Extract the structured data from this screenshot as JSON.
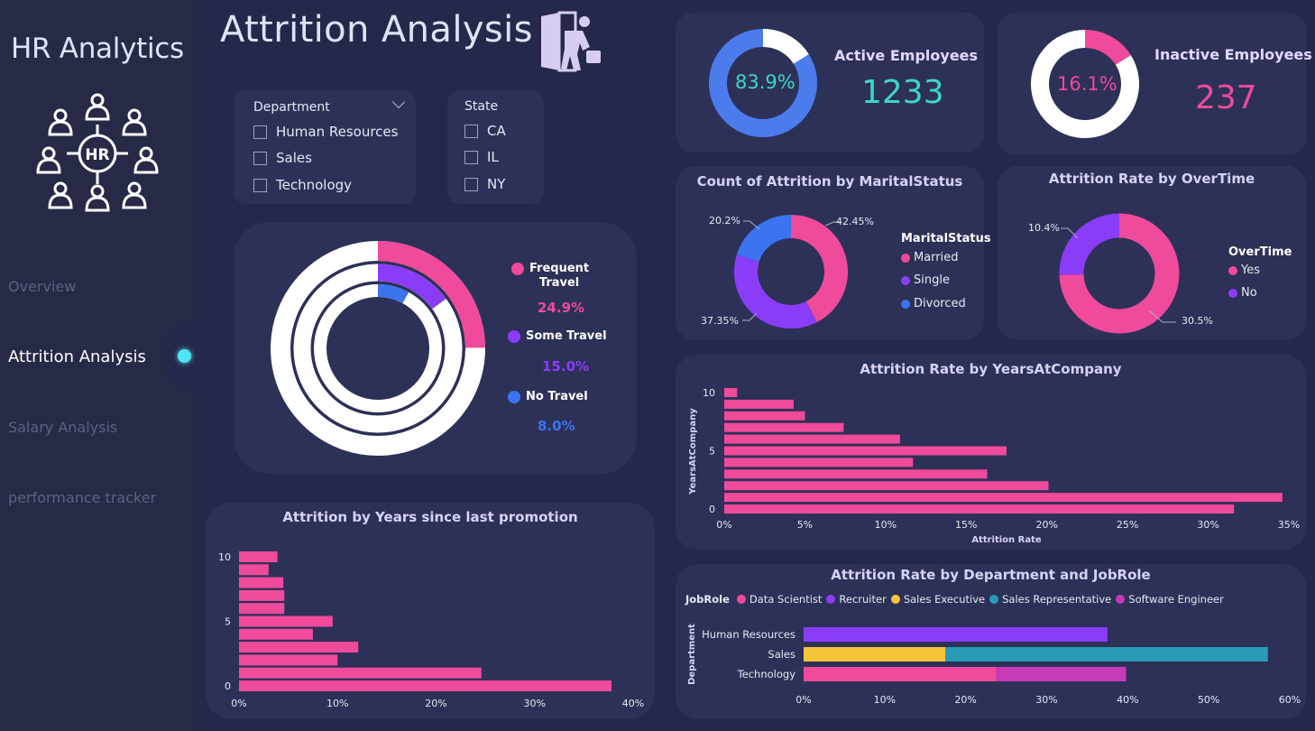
{
  "sidebar": {
    "app_title": "HR Analytics",
    "logo_text": "HR",
    "nav": [
      {
        "label": "Overview",
        "active": false
      },
      {
        "label": "Attrition Analysis",
        "active": true
      },
      {
        "label": "Salary Analysis",
        "active": false
      },
      {
        "label": "performance tracker",
        "active": false
      }
    ]
  },
  "page_title": "Attrition Analysis",
  "filters": {
    "department": {
      "title": "Department",
      "options": [
        "Human Resources",
        "Sales",
        "Technology"
      ]
    },
    "state": {
      "title": "State",
      "options": [
        "CA",
        "IL",
        "NY"
      ]
    }
  },
  "kpis": {
    "active": {
      "label": "Active Employees",
      "value": "1233",
      "percent_label": "83.9%",
      "percent": 83.9,
      "color": "#3ed6c8",
      "ring_color": "#4b7bec"
    },
    "inactive": {
      "label": "Inactive Employees",
      "value": "237",
      "percent_label": "16.1%",
      "percent": 16.1,
      "color": "#ef4a9b",
      "ring_color": "#ef4a9b"
    }
  },
  "colors": {
    "pink": "#ef4a9b",
    "purple": "#8b3cf7",
    "blue": "#3b73f0",
    "yellow": "#f7c53b",
    "teal": "#2a9bb7",
    "magenta": "#c63ab8"
  },
  "chart_data": [
    {
      "type": "pie",
      "title": "Count of Attrition by MaritalStatus",
      "legend_title": "MaritalStatus",
      "categories": [
        "Married",
        "Single",
        "Divorced"
      ],
      "values": [
        42.45,
        37.35,
        20.2
      ],
      "labels": [
        "42.45%",
        "37.35%",
        "20.2%"
      ],
      "colors": [
        "#ef4a9b",
        "#8b3cf7",
        "#3b73f0"
      ]
    },
    {
      "type": "pie",
      "title": "Attrition Rate by OverTime",
      "legend_title": "OverTime",
      "categories": [
        "Yes",
        "No"
      ],
      "values": [
        30.5,
        10.4
      ],
      "labels": [
        "30.5%",
        "10.4%"
      ],
      "colors": [
        "#ef4a9b",
        "#8b3cf7"
      ]
    },
    {
      "type": "pie",
      "title": "",
      "categories": [
        "Frequent Travel",
        "Some Travel",
        "No Travel"
      ],
      "values": [
        24.9,
        15.0,
        8.0
      ],
      "labels": [
        "24.9%",
        "15.0%",
        "8.0%"
      ],
      "colors": [
        "#ef4a9b",
        "#8b3cf7",
        "#3b73f0"
      ]
    },
    {
      "type": "bar",
      "orientation": "horizontal",
      "title": "Attrition Rate by YearsAtCompany",
      "xlabel": "Attrition Rate",
      "ylabel": "YearsAtCompany",
      "categories": [
        0,
        1,
        2,
        3,
        4,
        5,
        6,
        7,
        8,
        9,
        10
      ],
      "values": [
        31.6,
        34.6,
        20.1,
        16.3,
        11.7,
        17.5,
        10.9,
        7.4,
        5.0,
        4.3,
        0.8
      ],
      "xlim": [
        0,
        35
      ],
      "x_ticks": [
        "0%",
        "5%",
        "10%",
        "15%",
        "20%",
        "25%",
        "30%",
        "35%"
      ],
      "y_ticks": [
        "0",
        "5",
        "10"
      ]
    },
    {
      "type": "bar",
      "orientation": "horizontal",
      "title": "Attrition by Years since last promotion",
      "categories": [
        0,
        1,
        2,
        3,
        4,
        5,
        6,
        7,
        8,
        9,
        10
      ],
      "values": [
        37.8,
        24.6,
        10.0,
        12.1,
        7.5,
        9.5,
        4.6,
        4.6,
        4.5,
        3.0,
        3.9
      ],
      "xlim": [
        0,
        40
      ],
      "x_ticks": [
        "0%",
        "10%",
        "20%",
        "30%",
        "40%"
      ],
      "y_ticks": [
        "0",
        "5",
        "10"
      ]
    },
    {
      "type": "bar",
      "orientation": "horizontal",
      "stacked": true,
      "title": "Attrition Rate by Department and JobRole",
      "legend_title": "JobRole",
      "ylabel": "Department",
      "categories": [
        "Human Resources",
        "Sales",
        "Technology"
      ],
      "series": [
        {
          "name": "Data Scientist",
          "color": "#ef4a9b",
          "values": [
            0,
            0,
            23.8
          ]
        },
        {
          "name": "Recruiter",
          "color": "#8b3cf7",
          "values": [
            37.5,
            0,
            0
          ]
        },
        {
          "name": "Sales Executive",
          "color": "#f7c53b",
          "values": [
            0,
            17.5,
            0
          ]
        },
        {
          "name": "Sales Representative",
          "color": "#2a9bb7",
          "values": [
            0,
            39.8,
            0
          ]
        },
        {
          "name": "Software Engineer",
          "color": "#c63ab8",
          "values": [
            0,
            0,
            16.0
          ]
        }
      ],
      "xlim": [
        0,
        60
      ],
      "x_ticks": [
        "0%",
        "10%",
        "20%",
        "30%",
        "40%",
        "50%",
        "60%"
      ]
    }
  ]
}
